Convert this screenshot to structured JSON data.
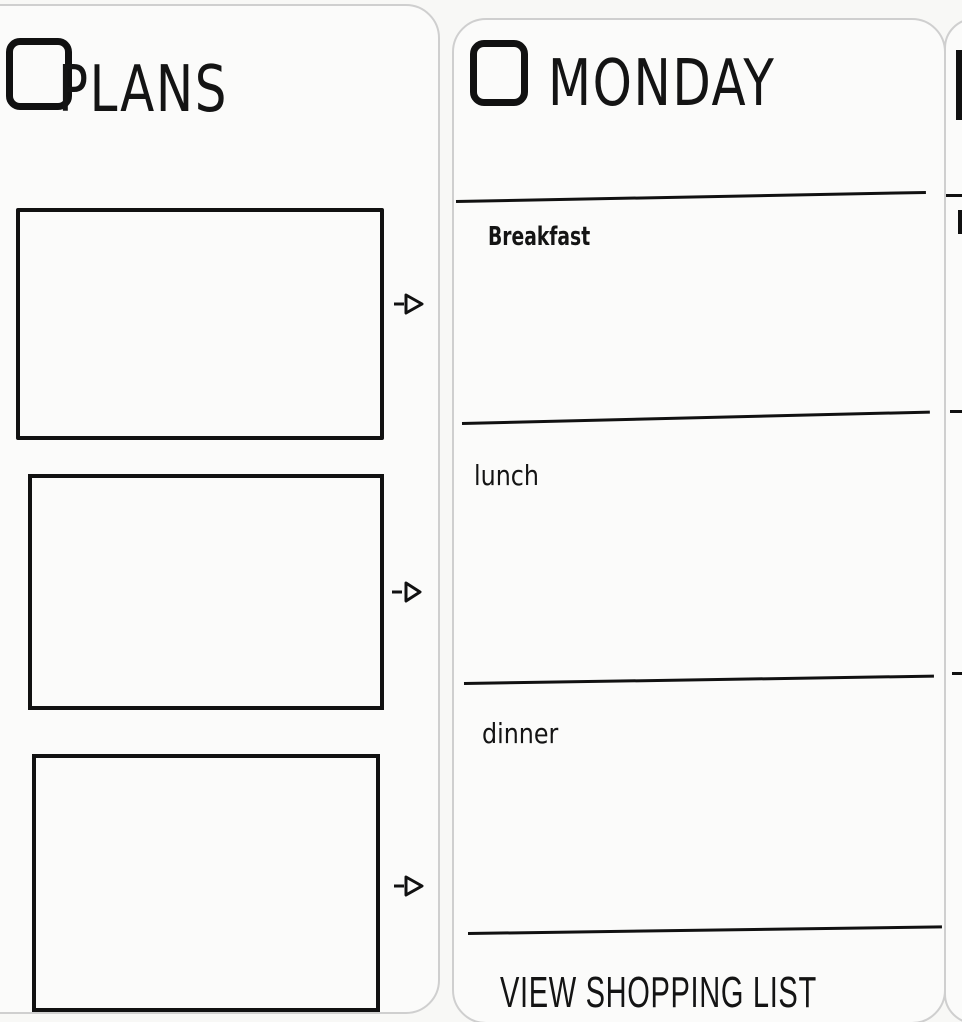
{
  "plans": {
    "title": "PLANS",
    "boxes": [
      {
        "arrow": "arrow-right-icon"
      },
      {
        "arrow": "arrow-right-icon"
      },
      {
        "arrow": "arrow-right-icon"
      }
    ]
  },
  "monday": {
    "title": "MONDAY",
    "meals": [
      "Breakfast",
      "lunch",
      "dinner"
    ],
    "shopping_button": "VIEW SHOPPING LIST"
  },
  "colors": {
    "ink": "#111111",
    "paper": "#f8f8f6",
    "card_border": "#cfcfcf"
  }
}
